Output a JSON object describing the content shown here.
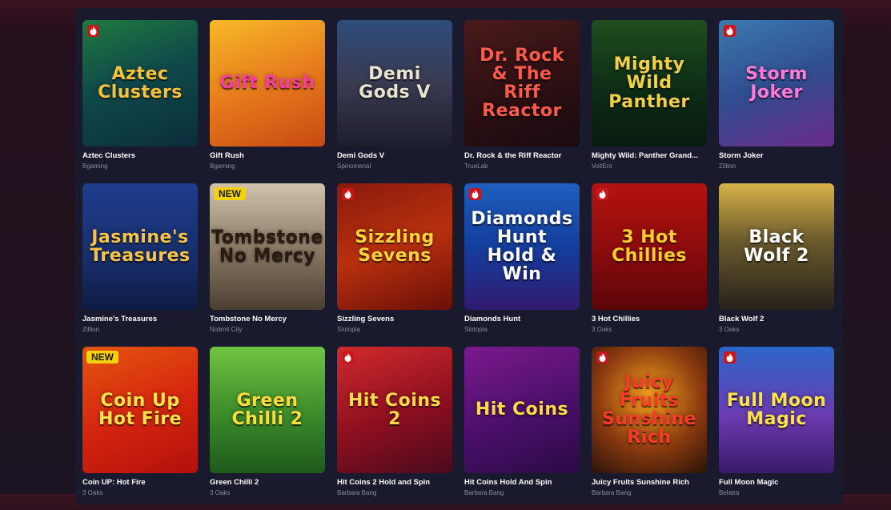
{
  "games": [
    {
      "name": "Aztec Clusters",
      "provider": "Bgaming",
      "art": "Aztec Clusters",
      "fire": true,
      "new": false,
      "bg": "linear-gradient(160deg,#1f7a3e,#0f4a4a 45%,#0b2e3c)",
      "fg": "#f7c23a"
    },
    {
      "name": "Gift Rush",
      "provider": "Bgaming",
      "art": "Gift Rush",
      "fire": false,
      "new": false,
      "bg": "linear-gradient(160deg,#f7b928,#e5761b 55%,#c84a12)",
      "fg": "#ff3da0"
    },
    {
      "name": "Demi Gods V",
      "provider": "Spinomenal",
      "art": "Demi Gods V",
      "fire": false,
      "new": false,
      "bg": "linear-gradient(180deg,#2d4c7a,#3a3a52 50%,#1d1e2c)",
      "fg": "#e9e2d0"
    },
    {
      "name": "Dr. Rock & the Riff Reactor",
      "provider": "TrueLab",
      "art": "Dr. Rock & The Riff Reactor",
      "fire": false,
      "new": false,
      "bg": "linear-gradient(160deg,#4a1a1a,#2a0f12 60%,#1a0a10)",
      "fg": "#ff5a4a"
    },
    {
      "name": "Mighty Wild: Panther Grand...",
      "provider": "VoltEnt",
      "art": "Mighty Wild Panther",
      "fire": false,
      "new": false,
      "bg": "linear-gradient(180deg,#1f4d1d,#0d2d16 55%,#071a0f)",
      "fg": "#f3d04a"
    },
    {
      "name": "Storm Joker",
      "provider": "Zillion",
      "art": "Storm Joker",
      "fire": true,
      "new": false,
      "bg": "linear-gradient(160deg,#3b7ab0,#304d8f 50%,#6b2a8b)",
      "fg": "#ff7ad9"
    },
    {
      "name": "Jasmine's Treasures",
      "provider": "Zillion",
      "art": "Jasmine's Treasures",
      "fire": false,
      "new": false,
      "bg": "linear-gradient(180deg,#1d3c8c,#19306f 55%,#0e1c44)",
      "fg": "#f6c449"
    },
    {
      "name": "Tombstone No Mercy",
      "provider": "Nolimit City",
      "art": "Tombstone No Mercy",
      "fire": false,
      "new": true,
      "bg": "linear-gradient(180deg,#cfc3ad,#8d7d68 50%,#4b3f31)",
      "fg": "#2a1a12"
    },
    {
      "name": "Sizzling Sevens",
      "provider": "Slotopia",
      "art": "Sizzling Sevens",
      "fire": true,
      "new": false,
      "bg": "linear-gradient(160deg,#8a1a0c,#b8300e 50%,#6a0f08)",
      "fg": "#ffd23a"
    },
    {
      "name": "Diamonds Hunt",
      "provider": "Slotopia",
      "art": "Diamonds Hunt Hold & Win",
      "fire": true,
      "new": false,
      "bg": "linear-gradient(180deg,#1e5fbd,#143e9e 50%,#301a6f)",
      "fg": "#ffffff"
    },
    {
      "name": "3 Hot Chillies",
      "provider": "3 Oaks",
      "art": "3 Hot Chillies",
      "fire": true,
      "new": false,
      "bg": "linear-gradient(180deg,#b3130f,#8b0b0c 55%,#5a0508)",
      "fg": "#ffcd2a"
    },
    {
      "name": "Black Wolf 2",
      "provider": "3 Oaks",
      "art": "Black Wolf 2",
      "fire": false,
      "new": false,
      "bg": "linear-gradient(180deg,#d8b24a,#6b5a2c 45%,#26221a)",
      "fg": "#ffffff"
    },
    {
      "name": "Coin UP: Hot Fire",
      "provider": "3 Oaks",
      "art": "Coin Up Hot Fire",
      "fire": false,
      "new": true,
      "bg": "linear-gradient(160deg,#e4560f,#d6270e 50%,#b3100c)",
      "fg": "#ffe14a"
    },
    {
      "name": "Green Chilli 2",
      "provider": "3 Oaks",
      "art": "Green Chilli 2",
      "fire": false,
      "new": false,
      "bg": "linear-gradient(180deg,#6fc441,#3a8a2a 55%,#1f5a1c)",
      "fg": "#ffdd3a"
    },
    {
      "name": "Hit Coins 2 Hold and Spin",
      "provider": "Barbara Bang",
      "art": "Hit Coins 2",
      "fire": true,
      "new": false,
      "bg": "linear-gradient(160deg,#d12a2c,#8c0f1f 55%,#4a0a1c)",
      "fg": "#ffd84a"
    },
    {
      "name": "Hit Coins Hold And Spin",
      "provider": "Barbara Bang",
      "art": "Hit Coins",
      "fire": false,
      "new": false,
      "bg": "linear-gradient(160deg,#7a1a8d,#4a0f6a 55%,#2a0a44)",
      "fg": "#ffd84a"
    },
    {
      "name": "Juicy Fruits Sunshine Rich",
      "provider": "Barbara Bang",
      "art": "Juicy Fruits Sunshine Rich",
      "fire": true,
      "new": false,
      "bg": "radial-gradient(circle at 50% 40%,#f7a21e,#8a3a0f 55%,#2a1208)",
      "fg": "#ff3a2a"
    },
    {
      "name": "Full Moon Magic",
      "provider": "Belatra",
      "art": "Full Moon Magic",
      "fire": true,
      "new": false,
      "bg": "linear-gradient(180deg,#2b66c9,#6b3bb0 55%,#3a1a6a)",
      "fg": "#ffe14a"
    }
  ],
  "badge_new_label": "NEW",
  "colors": {
    "fire": "#c8171b",
    "badge": "#f6d20d",
    "provider": "#8b8b9c",
    "panel": "#1a1a2e"
  }
}
